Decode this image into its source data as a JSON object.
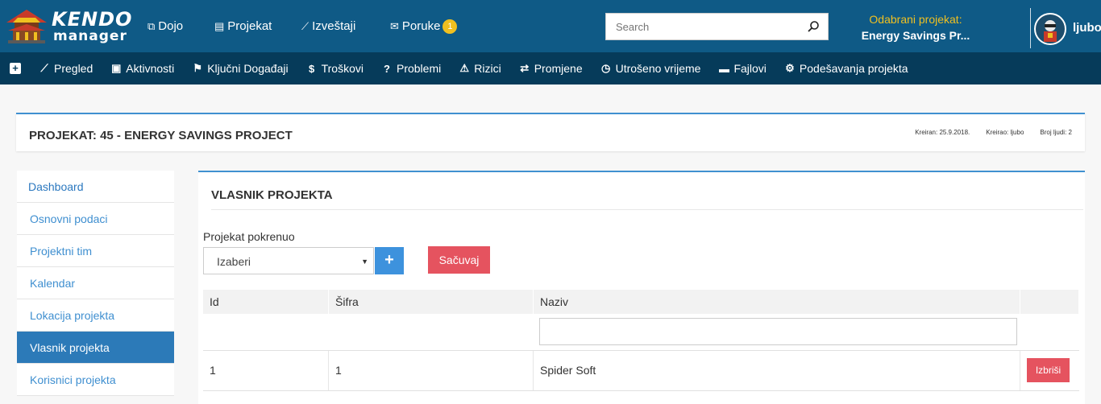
{
  "brand": {
    "line1": "KENDO",
    "line2": "manager"
  },
  "topnav": [
    {
      "label": "Dojo",
      "icon": "copy-icon",
      "glyph": "⧉"
    },
    {
      "label": "Projekat",
      "icon": "document-icon",
      "glyph": "▤"
    },
    {
      "label": "Izveštaji",
      "icon": "line-chart-icon",
      "glyph": "⟋"
    },
    {
      "label": "Poruke",
      "icon": "envelope-icon",
      "glyph": "✉",
      "badge": "1"
    }
  ],
  "search": {
    "placeholder": "Search"
  },
  "selected_project": {
    "label": "Odabrani projekat:",
    "name": "Energy Savings Pr..."
  },
  "user": {
    "name": "ljubo"
  },
  "subnav": [
    {
      "label": "Pregled",
      "icon": "line-chart-icon",
      "glyph": "⟋"
    },
    {
      "label": "Aktivnosti",
      "icon": "files-icon",
      "glyph": "▣"
    },
    {
      "label": "Ključni Događaji",
      "icon": "flag-icon",
      "glyph": "⚑"
    },
    {
      "label": "Troškovi",
      "icon": "dollar-icon",
      "glyph": "$"
    },
    {
      "label": "Problemi",
      "icon": "question-icon",
      "glyph": "?"
    },
    {
      "label": "Rizici",
      "icon": "warning-icon",
      "glyph": "⚠"
    },
    {
      "label": "Promjene",
      "icon": "exchange-icon",
      "glyph": "⇄"
    },
    {
      "label": "Utrošeno vrijeme",
      "icon": "clock-icon",
      "glyph": "◷"
    },
    {
      "label": "Fajlovi",
      "icon": "folder-icon",
      "glyph": "▬"
    },
    {
      "label": "Podešavanja projekta",
      "icon": "cogs-icon",
      "glyph": "⚙"
    }
  ],
  "project_header": {
    "title": "PROJEKAT: 45 - ENERGY SAVINGS PROJECT",
    "created_label": "Kreiran:",
    "created_value": "25.9.2018.",
    "creator_label": "Kreirao:",
    "creator_value": "ljubo",
    "people_label": "Broj ljudi:",
    "people_value": "2"
  },
  "sidebar": {
    "items": [
      {
        "label": "Dashboard"
      },
      {
        "label": "Osnovni podaci"
      },
      {
        "label": "Projektni tim"
      },
      {
        "label": "Kalendar"
      },
      {
        "label": "Lokacija projekta"
      },
      {
        "label": "Vlasnik projekta"
      },
      {
        "label": "Korisnici projekta"
      }
    ]
  },
  "panel": {
    "title": "VLASNIK PROJEKTA",
    "field_label": "Projekat pokrenuo",
    "select_value": "Izaberi",
    "add_label": "+",
    "save_label": "Sačuvaj"
  },
  "table": {
    "headers": [
      "Id",
      "Šifra",
      "Naziv",
      ""
    ],
    "filter_value": "",
    "rows": [
      {
        "id": "1",
        "sifra": "1",
        "naziv": "Spider Soft",
        "delete_label": "Izbriši"
      }
    ]
  },
  "colors": {
    "topbar": "#0f5a86",
    "subnav": "#063b5a",
    "accent_blue": "#3f90d0",
    "danger": "#e5535f",
    "badge": "#f0c020"
  }
}
